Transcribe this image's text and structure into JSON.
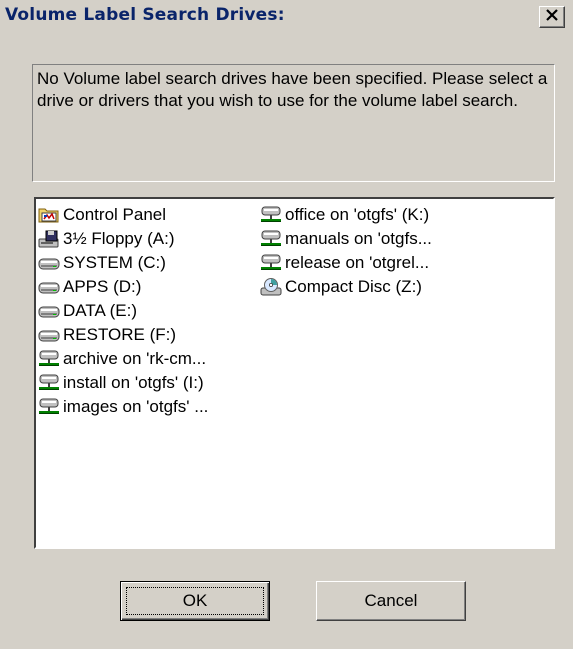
{
  "window": {
    "title": "Volume Label Search Drives:",
    "close_glyph": "✕"
  },
  "message": {
    "text": "No Volume label search drives have been specified. Please select a drive or drivers that you wish to use for the volume label search."
  },
  "drives": {
    "column1": [
      {
        "label": "Control Panel",
        "icon": "control-panel-icon"
      },
      {
        "label": "3½ Floppy (A:)",
        "icon": "floppy-drive-icon"
      },
      {
        "label": "SYSTEM (C:)",
        "icon": "hard-drive-icon"
      },
      {
        "label": "APPS (D:)",
        "icon": "hard-drive-icon"
      },
      {
        "label": "DATA (E:)",
        "icon": "hard-drive-icon"
      },
      {
        "label": "RESTORE (F:)",
        "icon": "hard-drive-icon"
      },
      {
        "label": "archive on 'rk-cm...",
        "icon": "network-drive-icon"
      },
      {
        "label": "install on 'otgfs' (I:)",
        "icon": "network-drive-icon"
      },
      {
        "label": "images on 'otgfs' ...",
        "icon": "network-drive-icon"
      }
    ],
    "column2": [
      {
        "label": "office on 'otgfs' (K:)",
        "icon": "network-drive-icon"
      },
      {
        "label": "manuals on 'otgfs...",
        "icon": "network-drive-icon"
      },
      {
        "label": "release on 'otgrel...",
        "icon": "network-drive-icon"
      },
      {
        "label": "Compact Disc (Z:)",
        "icon": "cd-drive-icon"
      }
    ]
  },
  "buttons": {
    "ok": "OK",
    "cancel": "Cancel"
  },
  "colors": {
    "dialog_bg": "#d4d0c8",
    "title_text": "#0a246a",
    "list_bg": "#ffffff"
  }
}
